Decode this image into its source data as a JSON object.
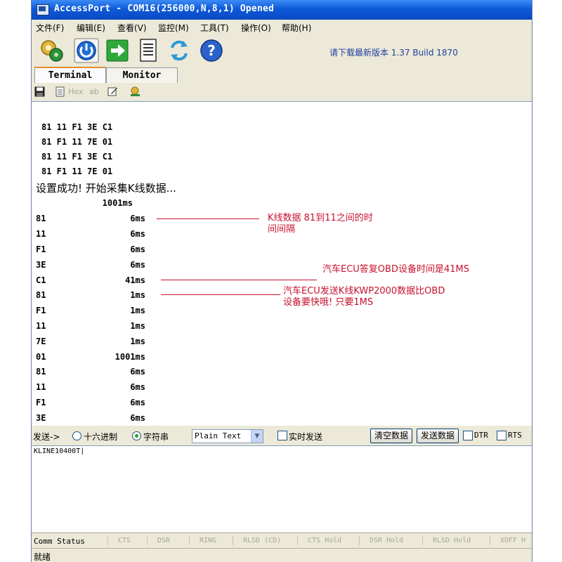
{
  "window": {
    "title": "AccessPort - COM16(256000,N,8,1) Opened"
  },
  "menu": [
    "文件(F)",
    "编辑(E)",
    "查看(V)",
    "监控(M)",
    "工具(T)",
    "操作(O)",
    "帮助(H)"
  ],
  "toolbar": {
    "version_text": "请下载最新版本 1.37 Build 1870"
  },
  "tabs": [
    "Terminal",
    "Monitor"
  ],
  "subtoolbar": {
    "hex_label": "Hex",
    "ab_label": "ab"
  },
  "terminal": {
    "hex_lines": [
      "81 11 F1 3E C1",
      "81 F1 11 7E 01",
      "81 11 F1 3E C1",
      "81 F1 11 7E 01"
    ],
    "status_line": "设置成功! 开始采集K线数据...",
    "first_interval": "1001ms",
    "rows": [
      {
        "byte": "81",
        "ms": "6ms"
      },
      {
        "byte": "11",
        "ms": "6ms"
      },
      {
        "byte": "F1",
        "ms": "6ms"
      },
      {
        "byte": "3E",
        "ms": "6ms"
      },
      {
        "byte": "C1",
        "ms": "41ms"
      },
      {
        "byte": "81",
        "ms": "1ms"
      },
      {
        "byte": "F1",
        "ms": "1ms"
      },
      {
        "byte": "11",
        "ms": "1ms"
      },
      {
        "byte": "7E",
        "ms": "1ms"
      },
      {
        "byte": "01",
        "ms": "1001ms"
      },
      {
        "byte": "81",
        "ms": "6ms"
      },
      {
        "byte": "11",
        "ms": "6ms"
      },
      {
        "byte": "F1",
        "ms": "6ms"
      },
      {
        "byte": "3E",
        "ms": "6ms"
      }
    ]
  },
  "annotations": {
    "a1_line1": "K线数据 81到11之间的时",
    "a1_line2": "间间隔",
    "a2": "汽车ECU答复OBD设备时间是41MS",
    "a3_line1": "汽车ECU发送K线KWP2000数据比OBD",
    "a3_line2": "设备要快哦! 只要1MS",
    "color": "#c8102e"
  },
  "sendbar": {
    "send_label": "发送->",
    "hex_option": "十六进制",
    "string_option": "字符串",
    "selected_option": "string",
    "format_value": "Plain Text",
    "realtime_label": "实时发送",
    "clear_button": "清空数据",
    "send_button": "发送数据",
    "dtr_label": "DTR",
    "rts_label": "RTS"
  },
  "send_input": {
    "value": "KLINE10400T|"
  },
  "status": {
    "label": "Comm Status",
    "signals": [
      "CTS",
      "DSR",
      "RING",
      "RLSD (CD)",
      "CTS Hold",
      "DSR Hold",
      "RLSD Hold",
      "XOFF H"
    ],
    "ready": "就绪"
  }
}
